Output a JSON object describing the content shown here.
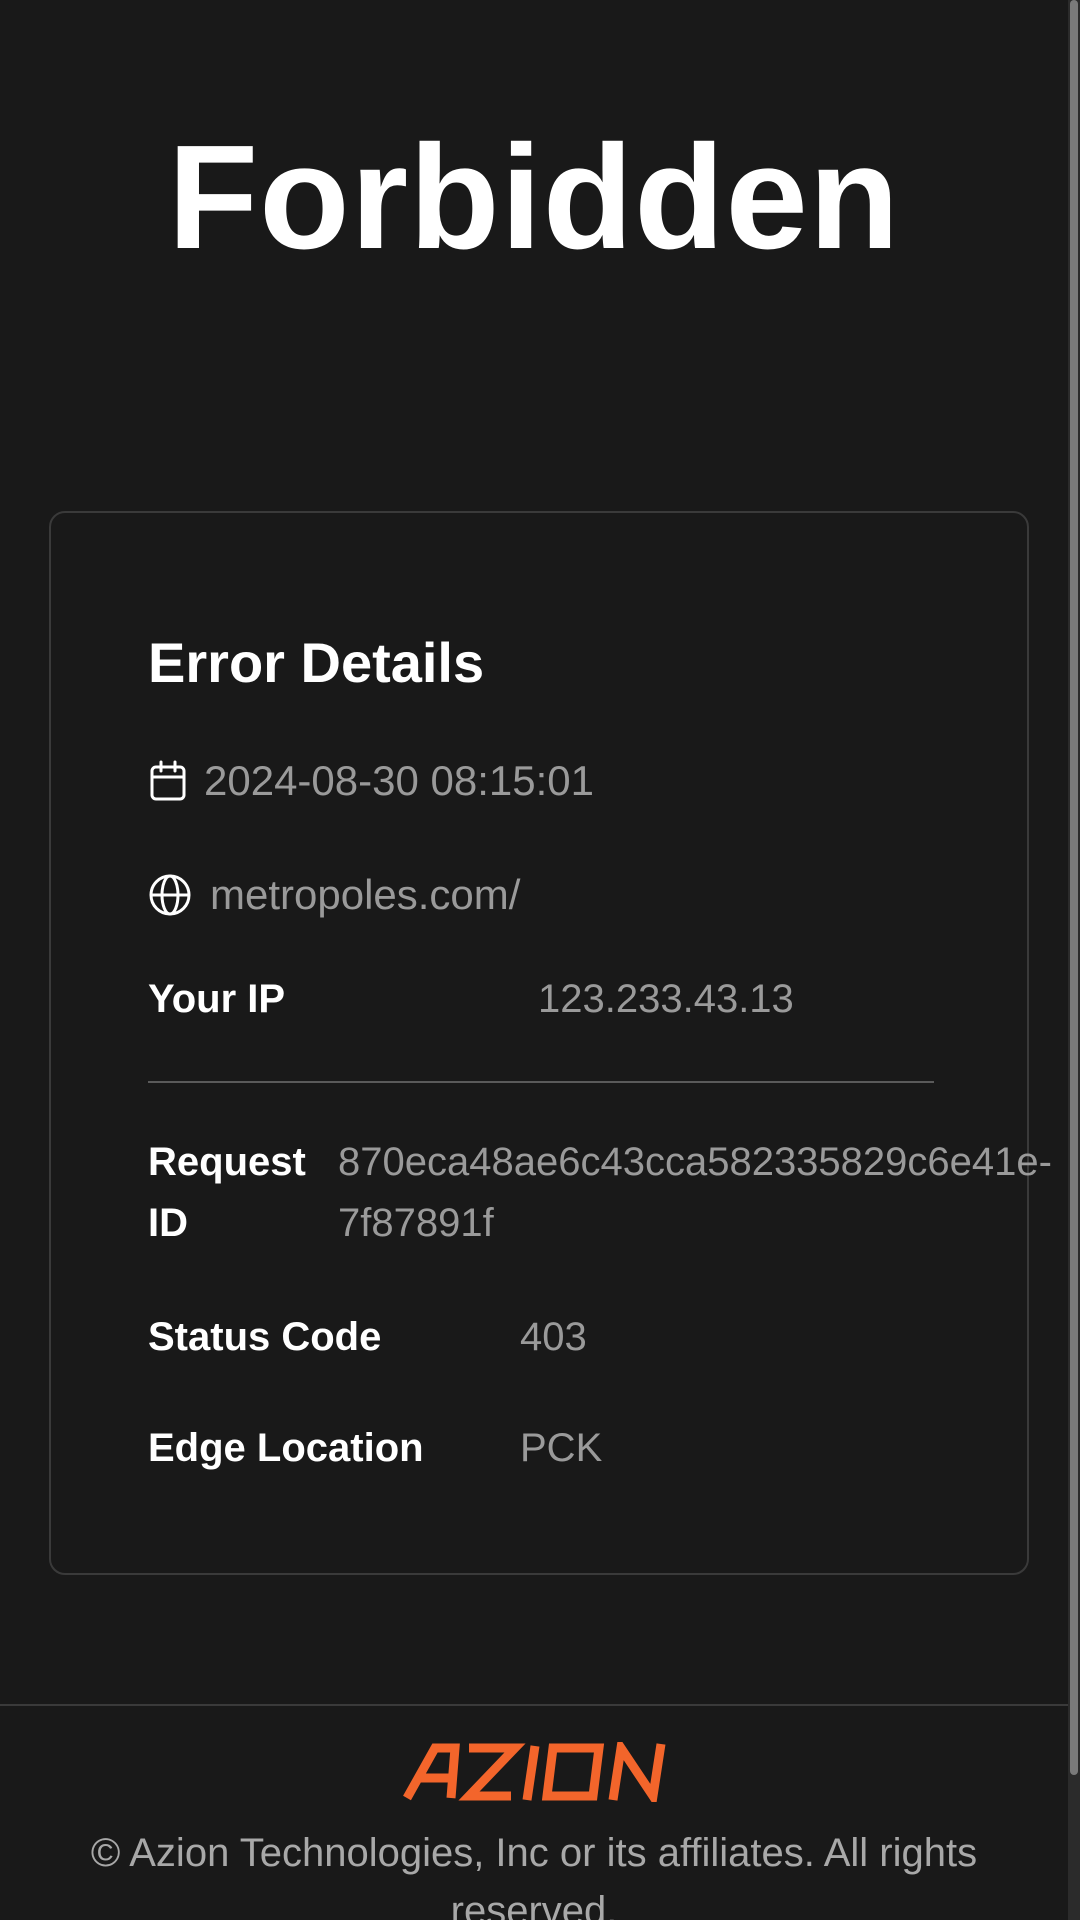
{
  "page": {
    "title": "Forbidden"
  },
  "error_details": {
    "heading": "Error Details",
    "timestamp": "2024-08-30 08:15:01",
    "url": "metropoles.com/",
    "your_ip_label": "Your IP",
    "your_ip_value": "123.233.43.13",
    "request_id_label_line1": "Request",
    "request_id_label_line2": "ID",
    "request_id_value_line1": "870eca48ae6c43cca582335829c6e41e-",
    "request_id_value_line2": "7f87891f",
    "status_code_label": "Status Code",
    "status_code_value": "403",
    "edge_location_label": "Edge Location",
    "edge_location_value": "PCK"
  },
  "footer": {
    "logo_text": "AZION",
    "copyright_line1": "© Azion Technologies, Inc or its affiliates. All rights",
    "copyright_line2": "reserved."
  },
  "colors": {
    "background": "#191919",
    "text_primary": "#ffffff",
    "text_secondary": "#9a9a9a",
    "brand_accent": "#f3652b"
  },
  "icons": {
    "timestamp": "calendar-icon",
    "url": "globe-icon"
  }
}
